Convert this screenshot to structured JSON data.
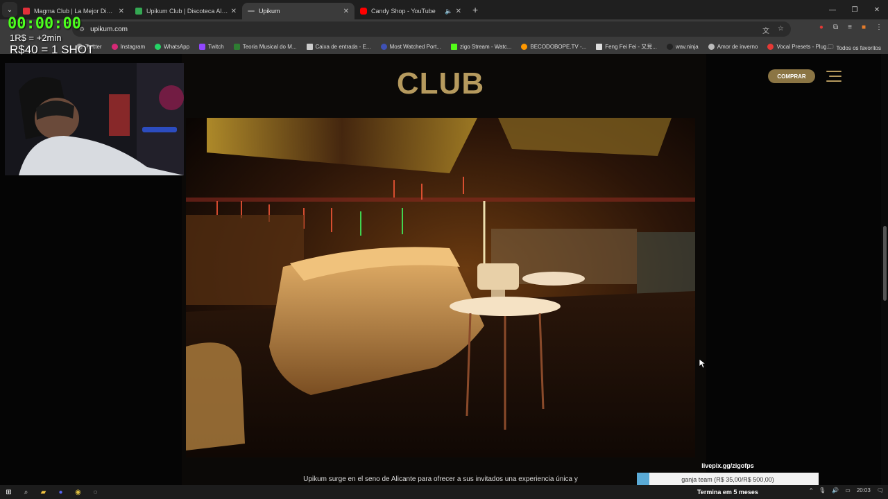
{
  "browser": {
    "tabs": [
      {
        "title": "Magma Club | La Mejor Discoteca",
        "favicon_color": "#e0303a"
      },
      {
        "title": "Upikum Club | Discoteca Alicante",
        "favicon_color": "#34a853"
      },
      {
        "title": "Upikum",
        "favicon_color": "#888888",
        "active": true
      },
      {
        "title": "Candy Shop - YouTube",
        "favicon_color": "#ff0000",
        "audio": true
      }
    ],
    "url": "upikum.com",
    "bookmarks": [
      {
        "label": "Twitter",
        "color": "#999999"
      },
      {
        "label": "Instagram",
        "color": "#d62976"
      },
      {
        "label": "WhatsApp",
        "color": "#25d366"
      },
      {
        "label": "Twitch",
        "color": "#9146ff"
      },
      {
        "label": "Teoria Musical do M...",
        "color": "#2e7d32"
      },
      {
        "label": "Caixa de entrada - E...",
        "color": "#cccccc"
      },
      {
        "label": "Most Watched Port...",
        "color": "#3f51b5"
      },
      {
        "label": "zigo Stream - Watc...",
        "color": "#53fc18"
      },
      {
        "label": "BECODOBOPE.TV -...",
        "color": "#ff9800"
      },
      {
        "label": "Feng Fei Fei - 又見...",
        "color": "#dddddd"
      },
      {
        "label": "wav.ninja",
        "color": "#222222"
      },
      {
        "label": "Amor de inverno",
        "color": "#bbbbbb"
      },
      {
        "label": "Vocal Presets - Plug...",
        "color": "#e53935"
      }
    ],
    "bookmarks_all": "Todos os favoritos"
  },
  "site": {
    "title": "CLUB",
    "buy_label": "COMPRAR",
    "description": "Upikum surge en el seno de Alicante para ofrecer a sus invitados una experiencia única y",
    "accent": "#b69a5e"
  },
  "stream": {
    "timer": "00:00:00",
    "rate_time": "1R$ = +2min",
    "rate_shot": "R$40 = 1 SHOT",
    "livepix": "livepix.gg/zigofps",
    "goal_label": "ganja team (R$ 35,00/R$ 500,00)",
    "goal_progress": 0.07,
    "goal_end": "Termina em 5 meses"
  },
  "taskbar": {
    "clock": "20:03"
  }
}
